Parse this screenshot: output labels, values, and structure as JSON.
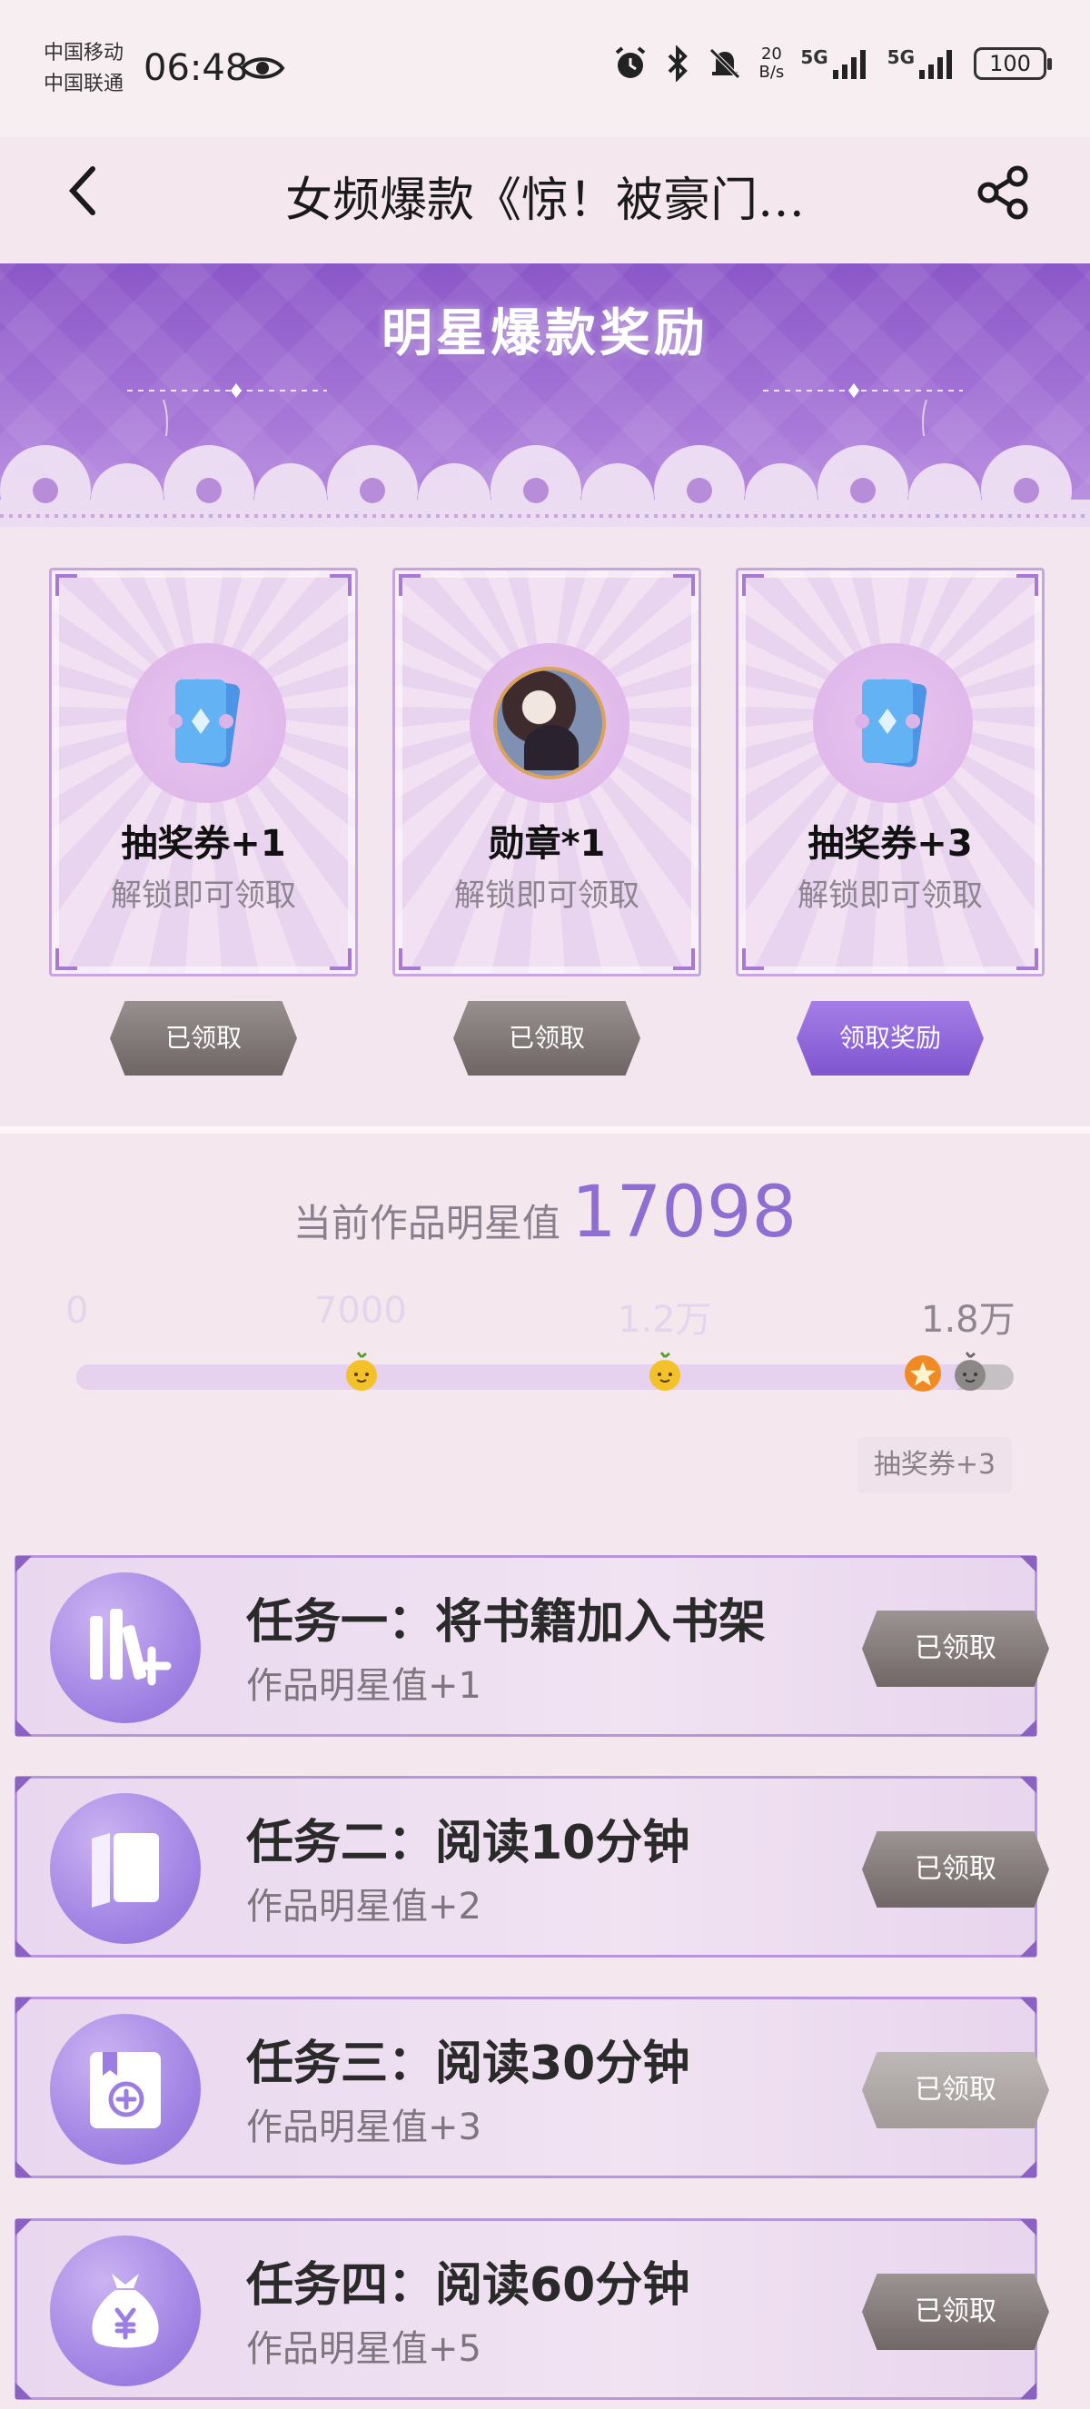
{
  "status_bar": {
    "carrier_1": "中国移动",
    "carrier_2": "中国联通",
    "time": "06:48",
    "net_speed_value": "20",
    "net_speed_unit": "B/s",
    "signal_1": "5G",
    "signal_2": "5G",
    "battery": "100"
  },
  "nav": {
    "title": "女频爆款《惊！被豪门…"
  },
  "banner": {
    "title": "明星爆款奖励"
  },
  "rewards": [
    {
      "name": "抽奖券+1",
      "desc": "解锁即可领取",
      "button": "已领取",
      "icon": "ticket-icon",
      "state": "claimed"
    },
    {
      "name": "勋章*1",
      "desc": "解锁即可领取",
      "button": "已领取",
      "icon": "medal-portrait",
      "state": "claimed"
    },
    {
      "name": "抽奖券+3",
      "desc": "解锁即可领取",
      "button": "领取奖励",
      "icon": "ticket-icon",
      "state": "available"
    }
  ],
  "progress": {
    "label": "当前作品明星值",
    "value": "17098",
    "current": 17098,
    "max": 18000,
    "milestones": [
      "0",
      "7000",
      "1.2万",
      "1.8万"
    ],
    "milestone_values": [
      0,
      7000,
      12000,
      18000
    ],
    "next_reward": "抽奖券+3"
  },
  "tasks": [
    {
      "title": "任务一：将书籍加入书架",
      "sub": "作品明星值+1",
      "button": "已领取",
      "icon": "bookshelf-add-icon"
    },
    {
      "title": "任务二：阅读10分钟",
      "sub": "作品明星值+2",
      "button": "已领取",
      "icon": "open-book-icon"
    },
    {
      "title": "任务三：阅读30分钟",
      "sub": "作品明星值+3",
      "button": "已领取",
      "icon": "bookmark-add-icon"
    },
    {
      "title": "任务四：阅读60分钟",
      "sub": "作品明星值+5",
      "button": "已领取",
      "icon": "money-bag-icon"
    }
  ],
  "colors": {
    "accent": "#8f6ed3",
    "banner": "#a777d8",
    "claimed_button": "#7d7473",
    "active_button": "#8f63d8"
  }
}
